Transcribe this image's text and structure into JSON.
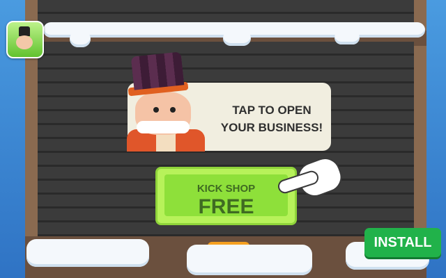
{
  "speech_bubble": {
    "text": "TAP TO OPEN\nYOUR BUSINESS!"
  },
  "cta_button": {
    "line1": "KICK SHOP",
    "line2": "FREE"
  },
  "install_button": {
    "label": "INSTALL"
  },
  "colors": {
    "button_green": "#8ee03a",
    "install_green": "#21b24a",
    "snow": "#f4f8fc",
    "shutter": "#3b3b3b"
  }
}
